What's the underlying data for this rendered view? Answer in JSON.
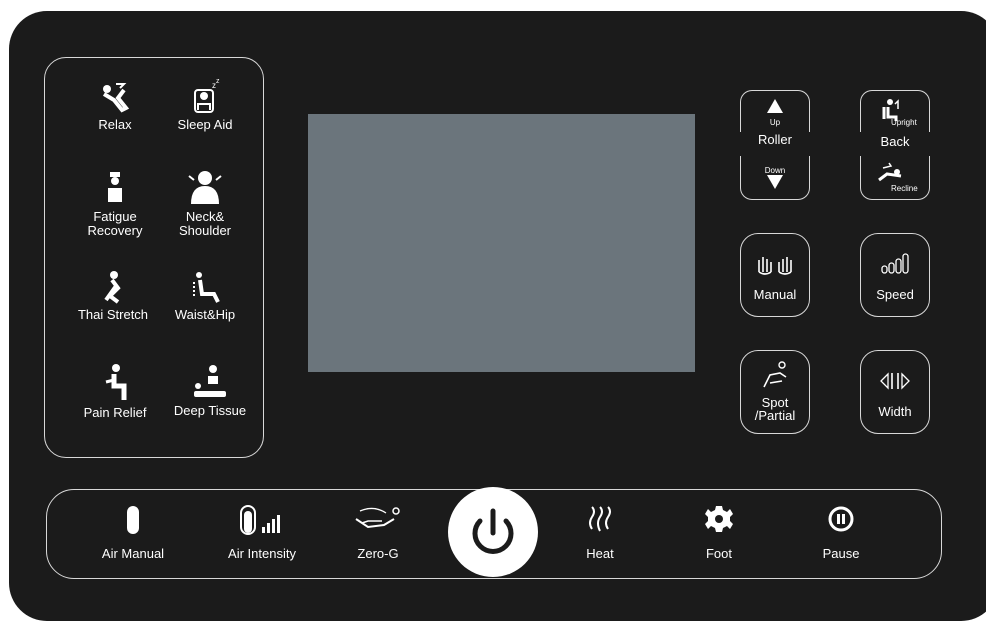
{
  "modes": [
    {
      "key": "relax",
      "label": "Relax",
      "icon": "relax-icon"
    },
    {
      "key": "sleep",
      "label": "Sleep Aid",
      "icon": "sleep-aid-icon"
    },
    {
      "key": "fatigue",
      "label": "Fatigue\nRecovery",
      "icon": "fatigue-recovery-icon"
    },
    {
      "key": "neck",
      "label": "Neck&\nShoulder",
      "icon": "neck-shoulder-icon"
    },
    {
      "key": "thai",
      "label": "Thai Stretch",
      "icon": "thai-stretch-icon"
    },
    {
      "key": "waist",
      "label": "Waist&Hip",
      "icon": "waist-hip-icon"
    },
    {
      "key": "pain",
      "label": "Pain Relief",
      "icon": "pain-relief-icon"
    },
    {
      "key": "deep",
      "label": "Deep Tissue",
      "icon": "deep-tissue-icon"
    }
  ],
  "roller": {
    "up": "Up",
    "label": "Roller",
    "down": "Down"
  },
  "back": {
    "upright": "Upright",
    "label": "Back",
    "recline": "Recline"
  },
  "manual": {
    "label": "Manual"
  },
  "speed": {
    "label": "Speed"
  },
  "spot": {
    "label": "Spot\n/Partial"
  },
  "width": {
    "label": "Width"
  },
  "bottom": {
    "air_manual": "Air Manual",
    "air_intensity": "Air Intensity",
    "zero_g": "Zero-G",
    "heat": "Heat",
    "foot": "Foot",
    "pause": "Pause"
  },
  "colors": {
    "panel": "#1b1b1b",
    "screen": "#6b757c",
    "outline": "#d8d8d8"
  }
}
